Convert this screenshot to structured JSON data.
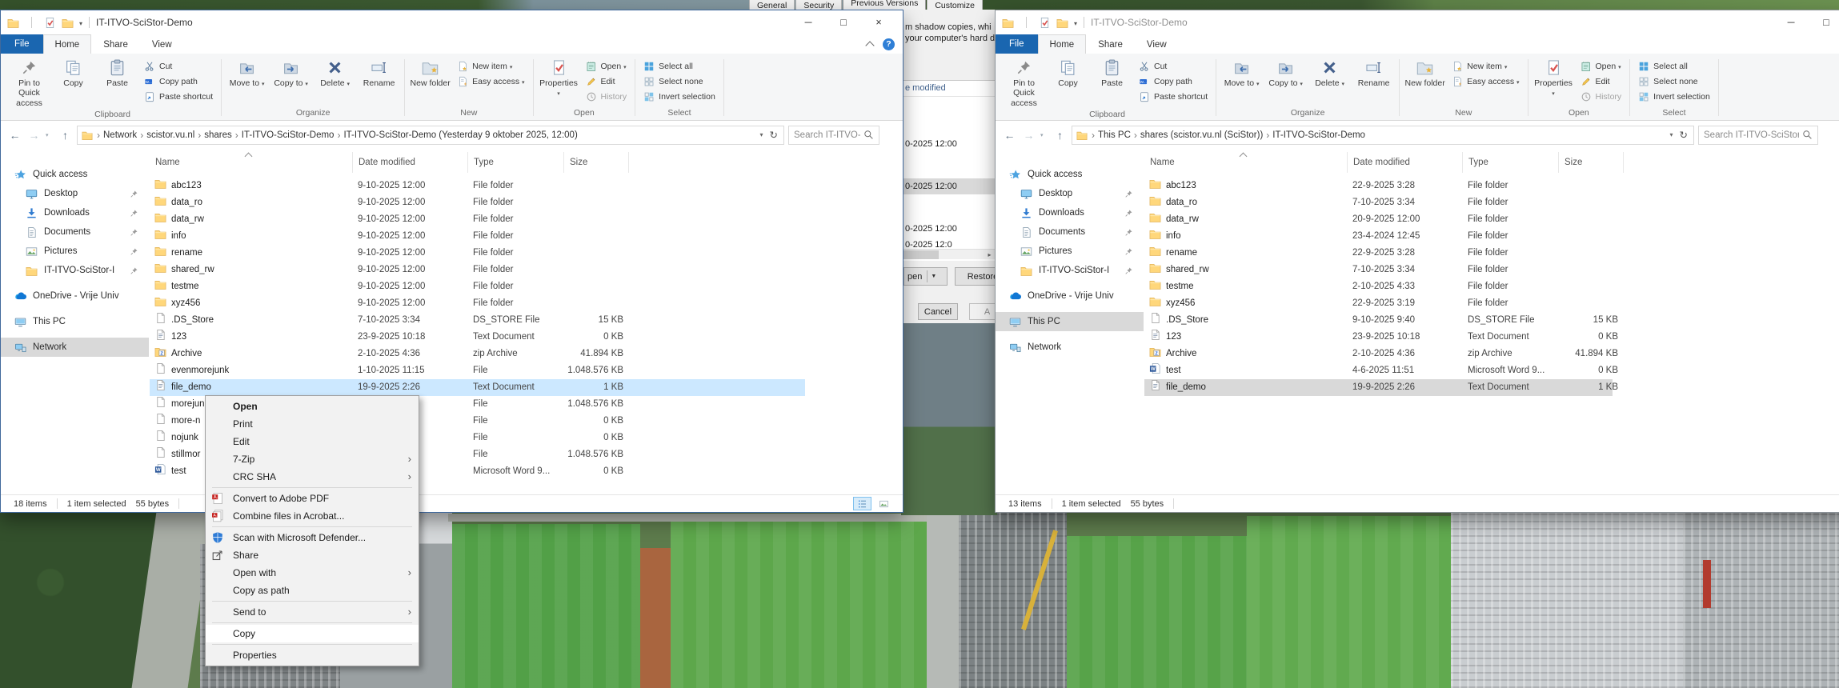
{
  "chrome": {
    "file_tab_color": "#1a66b0",
    "selection_active_color": "#cce8ff",
    "selection_inactive_color": "#d9d9d9",
    "help_button_color": "#2f7fd6"
  },
  "ribbon": {
    "tabs": [
      "File",
      "Home",
      "Share",
      "View"
    ],
    "selected_tab": "Home",
    "groups": [
      {
        "label": "Clipboard",
        "big": [
          {
            "label": "Pin to Quick access",
            "icon": "pin"
          },
          {
            "label": "Copy",
            "icon": "copy"
          },
          {
            "label": "Paste",
            "icon": "paste"
          }
        ],
        "small": [
          {
            "label": "Cut",
            "icon": "cut"
          },
          {
            "label": "Copy path",
            "icon": "copypath"
          },
          {
            "label": "Paste shortcut",
            "icon": "shortcut"
          }
        ]
      },
      {
        "label": "Organize",
        "big": [
          {
            "label": "Move to",
            "icon": "moveto",
            "dd": true
          },
          {
            "label": "Copy to",
            "icon": "copyto",
            "dd": true
          },
          {
            "label": "Delete",
            "icon": "delete",
            "dd": true
          },
          {
            "label": "Rename",
            "icon": "rename"
          }
        ],
        "small": []
      },
      {
        "label": "New",
        "big": [
          {
            "label": "New folder",
            "icon": "newfolder"
          }
        ],
        "small": [
          {
            "label": "New item",
            "icon": "newitem",
            "dd": true
          },
          {
            "label": "Easy access",
            "icon": "easyaccess",
            "dd": true
          }
        ]
      },
      {
        "label": "Open",
        "big": [
          {
            "label": "Properties",
            "icon": "properties",
            "dd": true
          }
        ],
        "small": [
          {
            "label": "Open",
            "icon": "open",
            "dd": true
          },
          {
            "label": "Edit",
            "icon": "edit"
          },
          {
            "label": "History",
            "icon": "history",
            "disabled": true
          }
        ]
      },
      {
        "label": "Select",
        "big": [],
        "small": [
          {
            "label": "Select all",
            "icon": "selall"
          },
          {
            "label": "Select none",
            "icon": "selnone"
          },
          {
            "label": "Invert selection",
            "icon": "invert"
          }
        ]
      }
    ]
  },
  "sidebar": {
    "items": [
      {
        "label": "Quick access",
        "icon": "star"
      },
      {
        "label": "Desktop",
        "icon": "desktop",
        "indent": true,
        "pin": true
      },
      {
        "label": "Downloads",
        "icon": "download",
        "indent": true,
        "pin": true
      },
      {
        "label": "Documents",
        "icon": "document",
        "indent": true,
        "pin": true
      },
      {
        "label": "Pictures",
        "icon": "pictures",
        "indent": true,
        "pin": true
      },
      {
        "label": "IT-ITVO-SciStor-I",
        "icon": "folder",
        "indent": true,
        "pin": true
      },
      {
        "label": "OneDrive - Vrije Univ",
        "icon": "onedrive",
        "gap": true
      },
      {
        "label": "This PC",
        "icon": "pc",
        "gap": true
      },
      {
        "label": "Network",
        "icon": "network",
        "gap": true
      }
    ]
  },
  "columns": [
    "Name",
    "Date modified",
    "Type",
    "Size"
  ],
  "left_window": {
    "title": "IT-ITVO-SciStor-Demo",
    "active": true,
    "selected_sidebar": "Network",
    "breadcrumbs": [
      "Network",
      "scistor.vu.nl",
      "shares",
      "IT-ITVO-SciStor-Demo",
      "IT-ITVO-SciStor-Demo (Yesterday 9 oktober 2025, 12:00)"
    ],
    "search_placeholder": "Search IT-ITVO-SciStor-Demo",
    "files": [
      {
        "name": "abc123",
        "date": "9-10-2025 12:00",
        "type": "File folder",
        "size": "",
        "icon": "folder"
      },
      {
        "name": "data_ro",
        "date": "9-10-2025 12:00",
        "type": "File folder",
        "size": "",
        "icon": "folder"
      },
      {
        "name": "data_rw",
        "date": "9-10-2025 12:00",
        "type": "File folder",
        "size": "",
        "icon": "folder"
      },
      {
        "name": "info",
        "date": "9-10-2025 12:00",
        "type": "File folder",
        "size": "",
        "icon": "folder"
      },
      {
        "name": "rename",
        "date": "9-10-2025 12:00",
        "type": "File folder",
        "size": "",
        "icon": "folder"
      },
      {
        "name": "shared_rw",
        "date": "9-10-2025 12:00",
        "type": "File folder",
        "size": "",
        "icon": "folder"
      },
      {
        "name": "testme",
        "date": "9-10-2025 12:00",
        "type": "File folder",
        "size": "",
        "icon": "folder"
      },
      {
        "name": "xyz456",
        "date": "9-10-2025 12:00",
        "type": "File folder",
        "size": "",
        "icon": "folder"
      },
      {
        "name": ".DS_Store",
        "date": "7-10-2025 3:34",
        "type": "DS_STORE File",
        "size": "15 KB",
        "icon": "file"
      },
      {
        "name": "123",
        "date": "23-9-2025 10:18",
        "type": "Text Document",
        "size": "0 KB",
        "icon": "textdoc"
      },
      {
        "name": "Archive",
        "date": "2-10-2025 4:36",
        "type": "zip Archive",
        "size": "41.894 KB",
        "icon": "zip"
      },
      {
        "name": "evenmorejunk",
        "date": "1-10-2025 11:15",
        "type": "File",
        "size": "1.048.576 KB",
        "icon": "file"
      },
      {
        "name": "file_demo",
        "date": "19-9-2025 2:26",
        "type": "Text Document",
        "size": "1 KB",
        "icon": "textdoc",
        "selected": true
      },
      {
        "name": "morejun",
        "date": "",
        "type": "File",
        "size": "1.048.576 KB",
        "icon": "file"
      },
      {
        "name": "more-n",
        "date": "",
        "type": "File",
        "size": "0 KB",
        "icon": "file"
      },
      {
        "name": "nojunk",
        "date": "",
        "type": "File",
        "size": "0 KB",
        "icon": "file"
      },
      {
        "name": "stillmor",
        "date": "",
        "type": "File",
        "size": "1.048.576 KB",
        "icon": "file"
      },
      {
        "name": "test",
        "date": "",
        "type": "Microsoft Word 9...",
        "size": "0 KB",
        "icon": "word"
      }
    ],
    "status": {
      "count": "18 items",
      "selection": "1 item selected",
      "size": "55 bytes"
    }
  },
  "right_window": {
    "title": "IT-ITVO-SciStor-Demo",
    "active": false,
    "selected_sidebar": "This PC",
    "breadcrumbs": [
      "This PC",
      "shares (scistor.vu.nl (SciStor))",
      "IT-ITVO-SciStor-Demo"
    ],
    "search_placeholder": "Search IT-ITVO-SciStor-De",
    "files": [
      {
        "name": "abc123",
        "date": "22-9-2025 3:28",
        "type": "File folder",
        "size": "",
        "icon": "folder"
      },
      {
        "name": "data_ro",
        "date": "7-10-2025 3:34",
        "type": "File folder",
        "size": "",
        "icon": "folder"
      },
      {
        "name": "data_rw",
        "date": "20-9-2025 12:00",
        "type": "File folder",
        "size": "",
        "icon": "folder"
      },
      {
        "name": "info",
        "date": "23-4-2024 12:45",
        "type": "File folder",
        "size": "",
        "icon": "folder"
      },
      {
        "name": "rename",
        "date": "22-9-2025 3:28",
        "type": "File folder",
        "size": "",
        "icon": "folder"
      },
      {
        "name": "shared_rw",
        "date": "7-10-2025 3:34",
        "type": "File folder",
        "size": "",
        "icon": "folder"
      },
      {
        "name": "testme",
        "date": "2-10-2025 4:33",
        "type": "File folder",
        "size": "",
        "icon": "folder"
      },
      {
        "name": "xyz456",
        "date": "22-9-2025 3:19",
        "type": "File folder",
        "size": "",
        "icon": "folder"
      },
      {
        "name": ".DS_Store",
        "date": "9-10-2025 9:40",
        "type": "DS_STORE File",
        "size": "15 KB",
        "icon": "file"
      },
      {
        "name": "123",
        "date": "23-9-2025 10:18",
        "type": "Text Document",
        "size": "0 KB",
        "icon": "textdoc"
      },
      {
        "name": "Archive",
        "date": "2-10-2025 4:36",
        "type": "zip Archive",
        "size": "41.894 KB",
        "icon": "zip"
      },
      {
        "name": "test",
        "date": "4-6-2025 11:51",
        "type": "Microsoft Word 9...",
        "size": "0 KB",
        "icon": "word"
      },
      {
        "name": "file_demo",
        "date": "19-9-2025 2:26",
        "type": "Text Document",
        "size": "1 KB",
        "icon": "textdoc",
        "selected": true
      }
    ],
    "status": {
      "count": "13 items",
      "selection": "1 item selected",
      "size": "55 bytes"
    }
  },
  "context_menu": {
    "items": [
      {
        "label": "Open",
        "bold": true
      },
      {
        "label": "Print"
      },
      {
        "label": "Edit"
      },
      {
        "label": "7-Zip",
        "submenu": true
      },
      {
        "label": "CRC SHA",
        "submenu": true
      },
      {
        "separator": true
      },
      {
        "label": "Convert to Adobe PDF",
        "icon": "pdf"
      },
      {
        "label": "Combine files in Acrobat...",
        "icon": "pdf2"
      },
      {
        "separator": true
      },
      {
        "label": "Scan with Microsoft Defender...",
        "icon": "defender"
      },
      {
        "label": "Share",
        "icon": "share"
      },
      {
        "label": "Open with",
        "submenu": true
      },
      {
        "label": "Copy as path"
      },
      {
        "separator": true
      },
      {
        "label": "Send to",
        "submenu": true
      },
      {
        "separator": true
      },
      {
        "label": "Copy",
        "highlight": true
      },
      {
        "separator": true
      },
      {
        "label": "Properties"
      }
    ]
  },
  "dialog": {
    "tabs": [
      "General",
      "Security",
      "Previous Versions",
      "Customize"
    ],
    "active_tab": "Previous Versions",
    "description_lines": [
      "m shadow copies, whi",
      "your computer's hard d"
    ],
    "list_header_fragment": "e modified",
    "rows": [
      {
        "text": "0-2025 12:00"
      },
      {
        "text": "0-2025 12:00",
        "selected": true
      },
      {
        "text": "0-2025 12:00"
      },
      {
        "text": "0-2025 12:0",
        "partial": true
      }
    ],
    "buttons": {
      "open_fragment": "pen",
      "restore": "Restore",
      "cancel": "Cancel",
      "apply_fragment": "A"
    }
  }
}
